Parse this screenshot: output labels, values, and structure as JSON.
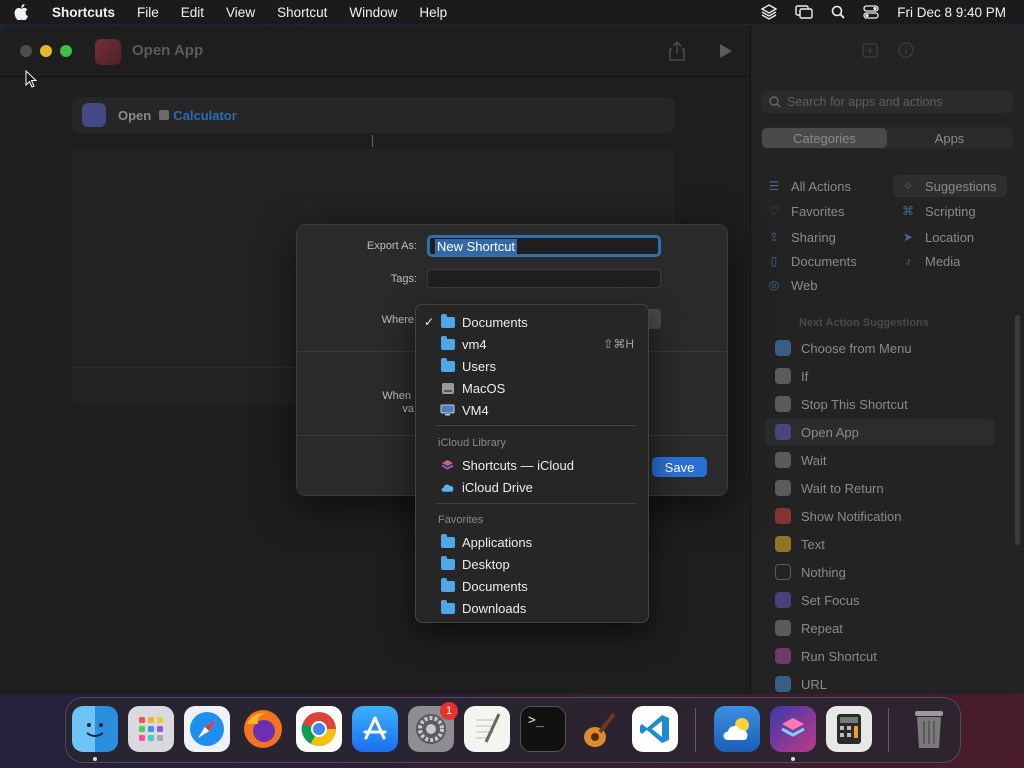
{
  "menubar": {
    "app": "Shortcuts",
    "items": [
      "File",
      "Edit",
      "View",
      "Shortcut",
      "Window",
      "Help"
    ],
    "datetime": "Fri Dec 8  9:40 PM"
  },
  "window": {
    "title": "Open App",
    "action": {
      "verb": "Open",
      "target": "Calculator"
    }
  },
  "sidebar": {
    "search_placeholder": "Search for apps and actions",
    "segments": [
      "Categories",
      "Apps"
    ],
    "categories_left": [
      "All Actions",
      "Favorites",
      "Sharing",
      "Documents",
      "Web"
    ],
    "categories_right": [
      "Suggestions",
      "Scripting",
      "Location",
      "Media"
    ],
    "next_header": "Next Action Suggestions",
    "suggestions": [
      "Choose from Menu",
      "If",
      "Stop This Shortcut",
      "Open App",
      "Wait",
      "Wait to Return",
      "Show Notification",
      "Text",
      "Nothing",
      "Set Focus",
      "Repeat",
      "Run Shortcut",
      "URL"
    ]
  },
  "sheet": {
    "export_label": "Export As:",
    "export_value": "New Shortcut",
    "tags_label": "Tags:",
    "where_label": "Where",
    "when_label_1": "When",
    "when_label_2": "va",
    "save": "Save"
  },
  "dropdown": {
    "locations": [
      {
        "label": "Documents",
        "checked": true
      },
      {
        "label": "vm4",
        "shortcut": "⇧⌘H"
      },
      {
        "label": "Users"
      },
      {
        "label": "MacOS"
      },
      {
        "label": "VM4"
      }
    ],
    "icloud_header": "iCloud Library",
    "icloud": [
      "Shortcuts — iCloud",
      "iCloud Drive"
    ],
    "favorites_header": "Favorites",
    "favorites": [
      "Applications",
      "Desktop",
      "Documents",
      "Downloads"
    ]
  },
  "dock": {
    "badge_count": "1",
    "terminal_prompt": ">_"
  },
  "colors": {
    "accent": "#2a6fd6",
    "folder": "#4fa6e8",
    "selection": "#3367a6"
  }
}
